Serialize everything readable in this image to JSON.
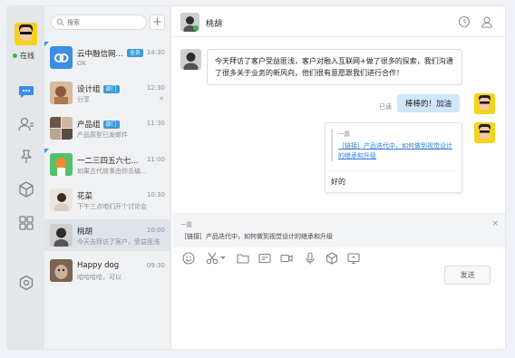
{
  "user": {
    "status": "在线"
  },
  "search": {
    "placeholder": "搜索"
  },
  "conversations": [
    {
      "name": "云中融信网...",
      "badge": "全员",
      "time": "14:30",
      "preview": "OK"
    },
    {
      "name": "设计组",
      "badge": "部门",
      "time": "12:30",
      "preview": "分享"
    },
    {
      "name": "产品组",
      "badge": "部门",
      "time": "11:30",
      "preview": "产品原型已发邮件"
    },
    {
      "name": "一二三四五六七...",
      "badge": "",
      "time": "11:00",
      "preview": "如果古代故事由你去编..."
    },
    {
      "name": "花菜",
      "badge": "",
      "time": "10:30",
      "preview": "下午三点咱们开个讨论会"
    },
    {
      "name": "桃胡",
      "badge": "",
      "time": "10:00",
      "preview": "今天去拜访了客户，受益匪浅..."
    },
    {
      "name": "Happy dog",
      "badge": "",
      "time": "09:30",
      "preview": "哈哈哈哈，可以"
    }
  ],
  "chat": {
    "title": "桃胡",
    "incoming_message": "今天拜访了客户受益匪浅，客户对融入互联网+做了很多的探索，我们沟通了很多关于业务的新风向，他们很有意愿跟我们进行合作！",
    "outgoing_message": "棒棒的！加油",
    "read_label": "已读",
    "quote": {
      "author": "一鼎",
      "link_text": "［链接］产品迭代中，如何做到视觉设计的继承和升级",
      "reply": "好的"
    }
  },
  "reply_preview": {
    "author": "一鼎",
    "text": "［链接］产品迭代中，如何做到视觉设计的继承和升级",
    "close": "×"
  },
  "composer": {
    "send_label": "发送"
  },
  "colors": {
    "accent": "#3a8ee6",
    "outgoing_bubble": "#cfe6fb",
    "online": "#3ab54a"
  }
}
